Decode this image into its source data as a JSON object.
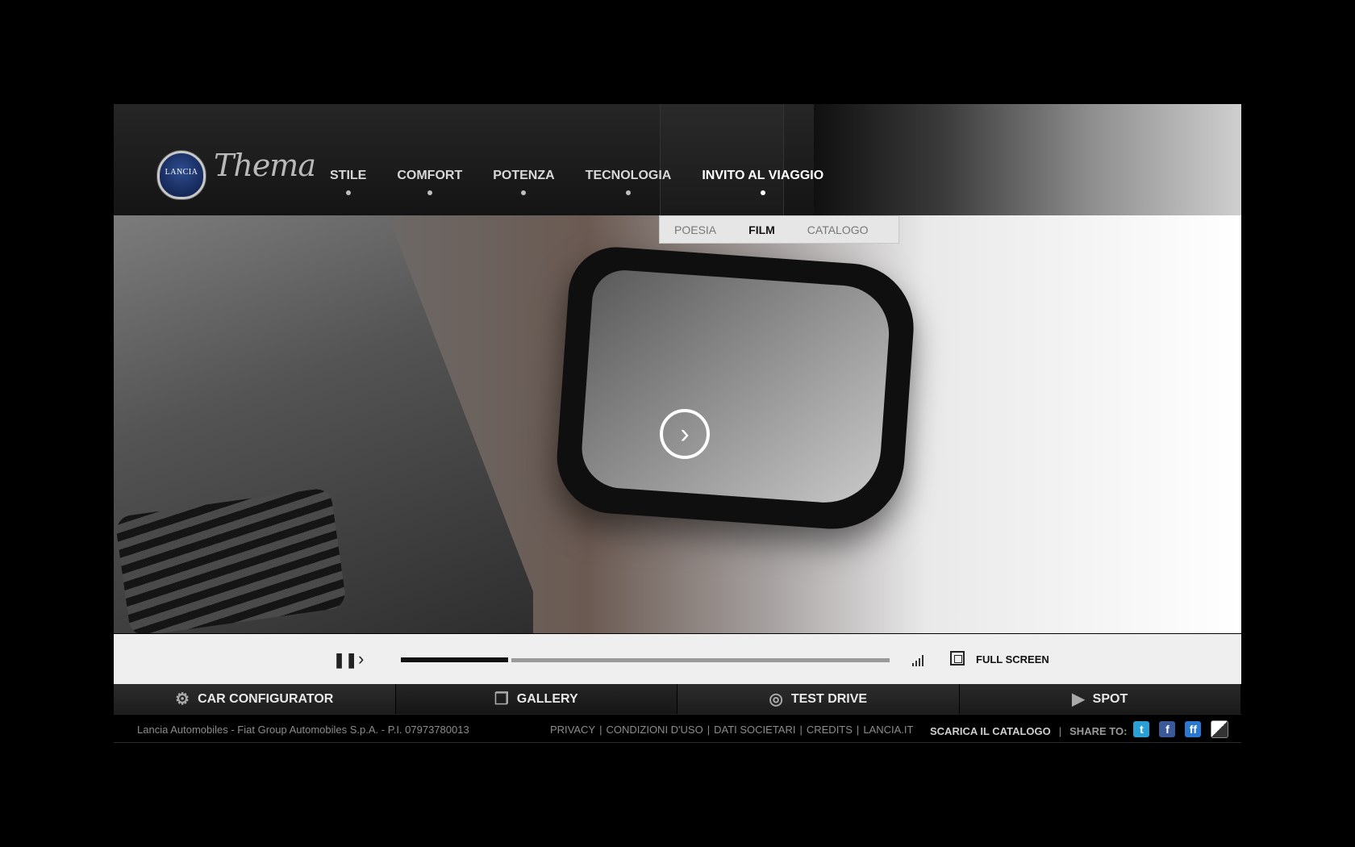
{
  "header": {
    "logo_text": "LANCIA",
    "brand_name": "Thema",
    "nav": [
      {
        "label": "STILE"
      },
      {
        "label": "COMFORT"
      },
      {
        "label": "POTENZA"
      },
      {
        "label": "TECNOLOGIA"
      },
      {
        "label": "INVITO AL VIAGGIO",
        "active": true
      }
    ]
  },
  "subnav": {
    "items": [
      {
        "label": "POESIA"
      },
      {
        "label": "FILM",
        "active": true
      },
      {
        "label": "CATALOGO"
      }
    ]
  },
  "video": {
    "center_icon": "play-circle-icon",
    "progress": 0.22
  },
  "controls": {
    "pause_icon": "pause-icon",
    "next_icon": "next-icon",
    "volume_icon": "volume-icon",
    "fullscreen_icon": "fullscreen-icon",
    "fullscreen_label": "FULL SCREEN"
  },
  "bottom_bar": [
    {
      "label": "CAR CONFIGURATOR",
      "icon": "gears-icon"
    },
    {
      "label": "GALLERY",
      "icon": "gallery-icon"
    },
    {
      "label": "TEST DRIVE",
      "icon": "steering-wheel-icon"
    },
    {
      "label": "SPOT",
      "icon": "video-camera-icon"
    }
  ],
  "footer": {
    "company": "Lancia Automobiles - Fiat Group Automobiles S.p.A. - P.I. 07973780013",
    "links": [
      "PRIVACY",
      "CONDIZIONI D'USO",
      "DATI SOCIETARI",
      "CREDITS",
      "LANCIA.IT"
    ],
    "link_separator": "|",
    "download_catalog": "SCARICA IL CATALOGO",
    "share_separator": "|",
    "share_label": "SHARE TO:",
    "social": [
      {
        "name": "twitter",
        "icon": "twitter-icon",
        "glyph": "t"
      },
      {
        "name": "facebook",
        "icon": "facebook-icon",
        "glyph": "f"
      },
      {
        "name": "friendfeed",
        "icon": "friendfeed-icon",
        "glyph": "ff"
      },
      {
        "name": "delicious",
        "icon": "delicious-icon",
        "glyph": ""
      }
    ]
  },
  "colors": {
    "background": "#000000",
    "header": "#1e1e1e",
    "active_nav": "#ffffff",
    "progress_fill": "#111111",
    "progress_track": "#9a9a9a"
  }
}
